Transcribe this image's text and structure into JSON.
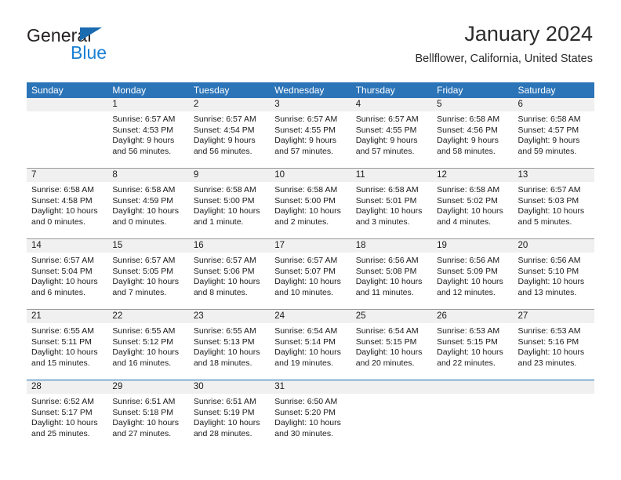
{
  "brand": {
    "name_top": "General",
    "name_bottom": "Blue",
    "triangle_color": "#1a6bb0",
    "blue_color": "#1a7fd4"
  },
  "header": {
    "title": "January 2024",
    "subtitle": "Bellflower, California, United States",
    "header_bg": "#2b74b8"
  },
  "weekday_headers": [
    "Sunday",
    "Monday",
    "Tuesday",
    "Wednesday",
    "Thursday",
    "Friday",
    "Saturday"
  ],
  "weeks": [
    [
      {
        "day": "",
        "sunrise": "",
        "sunset": "",
        "daylight_line1": "",
        "daylight_line2": "",
        "empty": true
      },
      {
        "day": "1",
        "sunrise": "Sunrise: 6:57 AM",
        "sunset": "Sunset: 4:53 PM",
        "daylight_line1": "Daylight: 9 hours",
        "daylight_line2": "and 56 minutes."
      },
      {
        "day": "2",
        "sunrise": "Sunrise: 6:57 AM",
        "sunset": "Sunset: 4:54 PM",
        "daylight_line1": "Daylight: 9 hours",
        "daylight_line2": "and 56 minutes."
      },
      {
        "day": "3",
        "sunrise": "Sunrise: 6:57 AM",
        "sunset": "Sunset: 4:55 PM",
        "daylight_line1": "Daylight: 9 hours",
        "daylight_line2": "and 57 minutes."
      },
      {
        "day": "4",
        "sunrise": "Sunrise: 6:57 AM",
        "sunset": "Sunset: 4:55 PM",
        "daylight_line1": "Daylight: 9 hours",
        "daylight_line2": "and 57 minutes."
      },
      {
        "day": "5",
        "sunrise": "Sunrise: 6:58 AM",
        "sunset": "Sunset: 4:56 PM",
        "daylight_line1": "Daylight: 9 hours",
        "daylight_line2": "and 58 minutes."
      },
      {
        "day": "6",
        "sunrise": "Sunrise: 6:58 AM",
        "sunset": "Sunset: 4:57 PM",
        "daylight_line1": "Daylight: 9 hours",
        "daylight_line2": "and 59 minutes."
      }
    ],
    [
      {
        "day": "7",
        "sunrise": "Sunrise: 6:58 AM",
        "sunset": "Sunset: 4:58 PM",
        "daylight_line1": "Daylight: 10 hours",
        "daylight_line2": "and 0 minutes."
      },
      {
        "day": "8",
        "sunrise": "Sunrise: 6:58 AM",
        "sunset": "Sunset: 4:59 PM",
        "daylight_line1": "Daylight: 10 hours",
        "daylight_line2": "and 0 minutes."
      },
      {
        "day": "9",
        "sunrise": "Sunrise: 6:58 AM",
        "sunset": "Sunset: 5:00 PM",
        "daylight_line1": "Daylight: 10 hours",
        "daylight_line2": "and 1 minute."
      },
      {
        "day": "10",
        "sunrise": "Sunrise: 6:58 AM",
        "sunset": "Sunset: 5:00 PM",
        "daylight_line1": "Daylight: 10 hours",
        "daylight_line2": "and 2 minutes."
      },
      {
        "day": "11",
        "sunrise": "Sunrise: 6:58 AM",
        "sunset": "Sunset: 5:01 PM",
        "daylight_line1": "Daylight: 10 hours",
        "daylight_line2": "and 3 minutes."
      },
      {
        "day": "12",
        "sunrise": "Sunrise: 6:58 AM",
        "sunset": "Sunset: 5:02 PM",
        "daylight_line1": "Daylight: 10 hours",
        "daylight_line2": "and 4 minutes."
      },
      {
        "day": "13",
        "sunrise": "Sunrise: 6:57 AM",
        "sunset": "Sunset: 5:03 PM",
        "daylight_line1": "Daylight: 10 hours",
        "daylight_line2": "and 5 minutes."
      }
    ],
    [
      {
        "day": "14",
        "sunrise": "Sunrise: 6:57 AM",
        "sunset": "Sunset: 5:04 PM",
        "daylight_line1": "Daylight: 10 hours",
        "daylight_line2": "and 6 minutes."
      },
      {
        "day": "15",
        "sunrise": "Sunrise: 6:57 AM",
        "sunset": "Sunset: 5:05 PM",
        "daylight_line1": "Daylight: 10 hours",
        "daylight_line2": "and 7 minutes."
      },
      {
        "day": "16",
        "sunrise": "Sunrise: 6:57 AM",
        "sunset": "Sunset: 5:06 PM",
        "daylight_line1": "Daylight: 10 hours",
        "daylight_line2": "and 8 minutes."
      },
      {
        "day": "17",
        "sunrise": "Sunrise: 6:57 AM",
        "sunset": "Sunset: 5:07 PM",
        "daylight_line1": "Daylight: 10 hours",
        "daylight_line2": "and 10 minutes."
      },
      {
        "day": "18",
        "sunrise": "Sunrise: 6:56 AM",
        "sunset": "Sunset: 5:08 PM",
        "daylight_line1": "Daylight: 10 hours",
        "daylight_line2": "and 11 minutes."
      },
      {
        "day": "19",
        "sunrise": "Sunrise: 6:56 AM",
        "sunset": "Sunset: 5:09 PM",
        "daylight_line1": "Daylight: 10 hours",
        "daylight_line2": "and 12 minutes."
      },
      {
        "day": "20",
        "sunrise": "Sunrise: 6:56 AM",
        "sunset": "Sunset: 5:10 PM",
        "daylight_line1": "Daylight: 10 hours",
        "daylight_line2": "and 13 minutes."
      }
    ],
    [
      {
        "day": "21",
        "sunrise": "Sunrise: 6:55 AM",
        "sunset": "Sunset: 5:11 PM",
        "daylight_line1": "Daylight: 10 hours",
        "daylight_line2": "and 15 minutes."
      },
      {
        "day": "22",
        "sunrise": "Sunrise: 6:55 AM",
        "sunset": "Sunset: 5:12 PM",
        "daylight_line1": "Daylight: 10 hours",
        "daylight_line2": "and 16 minutes."
      },
      {
        "day": "23",
        "sunrise": "Sunrise: 6:55 AM",
        "sunset": "Sunset: 5:13 PM",
        "daylight_line1": "Daylight: 10 hours",
        "daylight_line2": "and 18 minutes."
      },
      {
        "day": "24",
        "sunrise": "Sunrise: 6:54 AM",
        "sunset": "Sunset: 5:14 PM",
        "daylight_line1": "Daylight: 10 hours",
        "daylight_line2": "and 19 minutes."
      },
      {
        "day": "25",
        "sunrise": "Sunrise: 6:54 AM",
        "sunset": "Sunset: 5:15 PM",
        "daylight_line1": "Daylight: 10 hours",
        "daylight_line2": "and 20 minutes."
      },
      {
        "day": "26",
        "sunrise": "Sunrise: 6:53 AM",
        "sunset": "Sunset: 5:15 PM",
        "daylight_line1": "Daylight: 10 hours",
        "daylight_line2": "and 22 minutes."
      },
      {
        "day": "27",
        "sunrise": "Sunrise: 6:53 AM",
        "sunset": "Sunset: 5:16 PM",
        "daylight_line1": "Daylight: 10 hours",
        "daylight_line2": "and 23 minutes."
      }
    ],
    [
      {
        "day": "28",
        "sunrise": "Sunrise: 6:52 AM",
        "sunset": "Sunset: 5:17 PM",
        "daylight_line1": "Daylight: 10 hours",
        "daylight_line2": "and 25 minutes."
      },
      {
        "day": "29",
        "sunrise": "Sunrise: 6:51 AM",
        "sunset": "Sunset: 5:18 PM",
        "daylight_line1": "Daylight: 10 hours",
        "daylight_line2": "and 27 minutes."
      },
      {
        "day": "30",
        "sunrise": "Sunrise: 6:51 AM",
        "sunset": "Sunset: 5:19 PM",
        "daylight_line1": "Daylight: 10 hours",
        "daylight_line2": "and 28 minutes."
      },
      {
        "day": "31",
        "sunrise": "Sunrise: 6:50 AM",
        "sunset": "Sunset: 5:20 PM",
        "daylight_line1": "Daylight: 10 hours",
        "daylight_line2": "and 30 minutes."
      },
      {
        "day": "",
        "sunrise": "",
        "sunset": "",
        "daylight_line1": "",
        "daylight_line2": "",
        "empty": true
      },
      {
        "day": "",
        "sunrise": "",
        "sunset": "",
        "daylight_line1": "",
        "daylight_line2": "",
        "empty": true
      },
      {
        "day": "",
        "sunrise": "",
        "sunset": "",
        "daylight_line1": "",
        "daylight_line2": "",
        "empty": true
      }
    ]
  ]
}
